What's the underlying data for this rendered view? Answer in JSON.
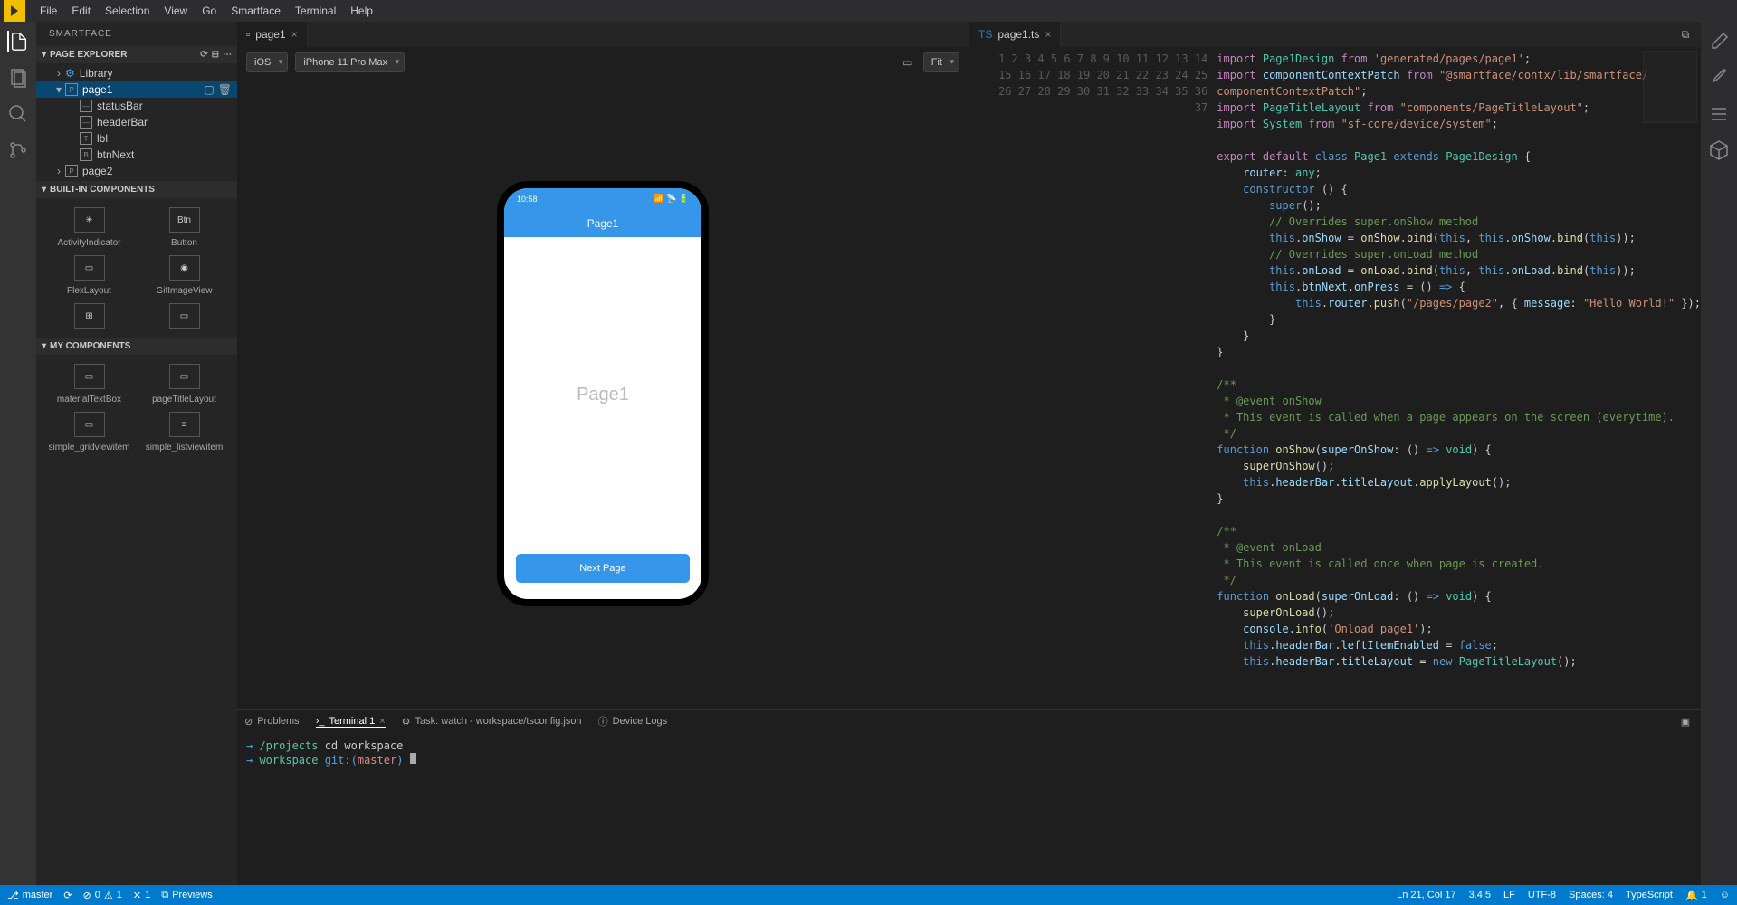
{
  "menu": [
    "File",
    "Edit",
    "Selection",
    "View",
    "Go",
    "Smartface",
    "Terminal",
    "Help"
  ],
  "sidebar_title": "SMARTFACE",
  "sections": {
    "page_explorer": "PAGE EXPLORER",
    "built_in": "BUILT-IN COMPONENTS",
    "my_comp": "MY COMPONENTS"
  },
  "tree": {
    "library": "Library",
    "page1": "page1",
    "statusBar": "statusBar",
    "headerBar": "headerBar",
    "lbl": "lbl",
    "btnNext": "btnNext",
    "page2": "page2"
  },
  "builtins": [
    "ActivityIndicator",
    "Button",
    "FlexLayout",
    "GifImageView"
  ],
  "mycomps": [
    "materialTextBox",
    "pageTitleLayout",
    "simple_gridviewitem",
    "simple_listviewitem"
  ],
  "designer": {
    "tab_label": "page1",
    "os_select": "iOS",
    "device_select": "iPhone 11 Pro Max",
    "zoom_select": "Fit",
    "status_time": "10:58",
    "header_title": "Page1",
    "page_label": "Page1",
    "next_btn": "Next Page"
  },
  "editor": {
    "tab_label": "page1.ts",
    "line_numbers": [
      1,
      2,
      3,
      4,
      5,
      6,
      7,
      8,
      9,
      10,
      11,
      12,
      13,
      14,
      15,
      16,
      17,
      18,
      19,
      20,
      21,
      22,
      23,
      24,
      25,
      26,
      27,
      28,
      29,
      30,
      31,
      32,
      33,
      34,
      35,
      36,
      37
    ]
  },
  "bottom_tabs": {
    "problems": "Problems",
    "terminal": "Terminal 1",
    "task": "Task: watch - workspace/tsconfig.json",
    "device_logs": "Device Logs"
  },
  "terminal": {
    "line1_prefix": "→  ",
    "line1_path": "/projects",
    "line1_cmd": " cd workspace",
    "line2_prefix": "→  ",
    "line2_path": "workspace",
    "line2_git": " git:(",
    "line2_branch": "master",
    "line2_close": ") "
  },
  "status_bar": {
    "branch": "master",
    "errors": "0",
    "warnings": "1",
    "xmarks": "1",
    "previews": "Previews",
    "cursor": "Ln 21, Col 17",
    "version": "3.4.5",
    "eol": "LF",
    "encoding": "UTF-8",
    "spaces": "Spaces: 4",
    "lang": "TypeScript",
    "bell_count": "1"
  },
  "btn_label": "Btn"
}
